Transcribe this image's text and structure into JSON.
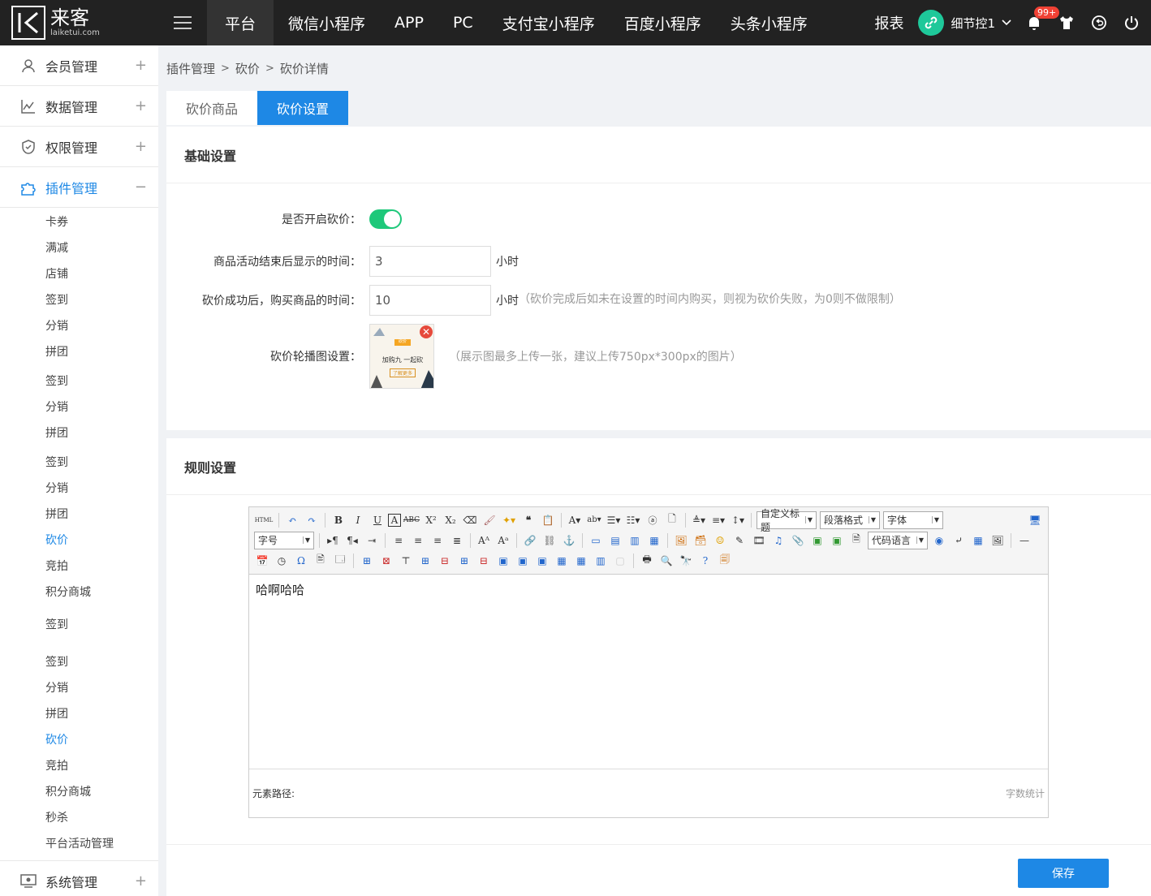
{
  "logo": {
    "cn": "来客",
    "en": "laiketui.com"
  },
  "nav": [
    "平台",
    "微信小程序",
    "APP",
    "PC",
    "支付宝小程序",
    "百度小程序",
    "头条小程序"
  ],
  "header": {
    "report": "报表",
    "user": "细节控1",
    "badge": "99+"
  },
  "sidebar": {
    "groups": [
      {
        "label": "会员管理",
        "icon": "user-icon",
        "toggle": "+"
      },
      {
        "label": "数据管理",
        "icon": "chart-icon",
        "toggle": "+"
      },
      {
        "label": "权限管理",
        "icon": "shield-icon",
        "toggle": "+"
      },
      {
        "label": "插件管理",
        "icon": "puzzle-icon",
        "toggle": "−"
      }
    ],
    "sub": [
      "卡券",
      "满减",
      "店铺",
      "签到",
      "分销",
      "拼团",
      "签到",
      "分销",
      "拼团",
      "签到",
      "分销",
      "拼团",
      "砍价",
      "竞拍",
      "积分商城",
      "签到",
      "签到",
      "分销",
      "拼团",
      "砍价",
      "竞拍",
      "积分商城",
      "秒杀",
      "平台活动管理"
    ],
    "bottom": {
      "label": "系统管理",
      "icon": "monitor-icon",
      "toggle": "+"
    }
  },
  "breadcrumb": [
    "插件管理",
    "砍价",
    "砍价详情"
  ],
  "tabs": [
    "砍价商品",
    "砍价设置"
  ],
  "basic": {
    "title": "基础设置",
    "enable_label": "是否开启砍价：",
    "show_time_label": "商品活动结束后显示的时间：",
    "show_time_value": "3",
    "show_time_unit": "小时",
    "buy_time_label": "砍价成功后，购买商品的时间：",
    "buy_time_value": "10",
    "buy_time_unit": "小时",
    "buy_time_hint": "（砍价完成后如未在设置的时间内购买，则视为砍价失败，为0则不做限制）",
    "banner_label": "砍价轮播图设置：",
    "banner_hint": "（展示图最多上传一张，建议上传750px*300px的图片）",
    "banner_text": [
      "砍价",
      "加购九 一起砍",
      "了解更多"
    ]
  },
  "rules": {
    "title": "规则设置",
    "content": "哈啊哈哈",
    "path_label": "元素路径:",
    "count_label": "字数统计",
    "selects": [
      "自定义标题",
      "段落格式",
      "字体",
      "字号",
      "代码语言"
    ],
    "html_btn": "HTML"
  },
  "save_label": "保存",
  "colors": {
    "primary": "#1e88e5",
    "toggle_on": "#1ec87a",
    "topbar": "#222222"
  }
}
